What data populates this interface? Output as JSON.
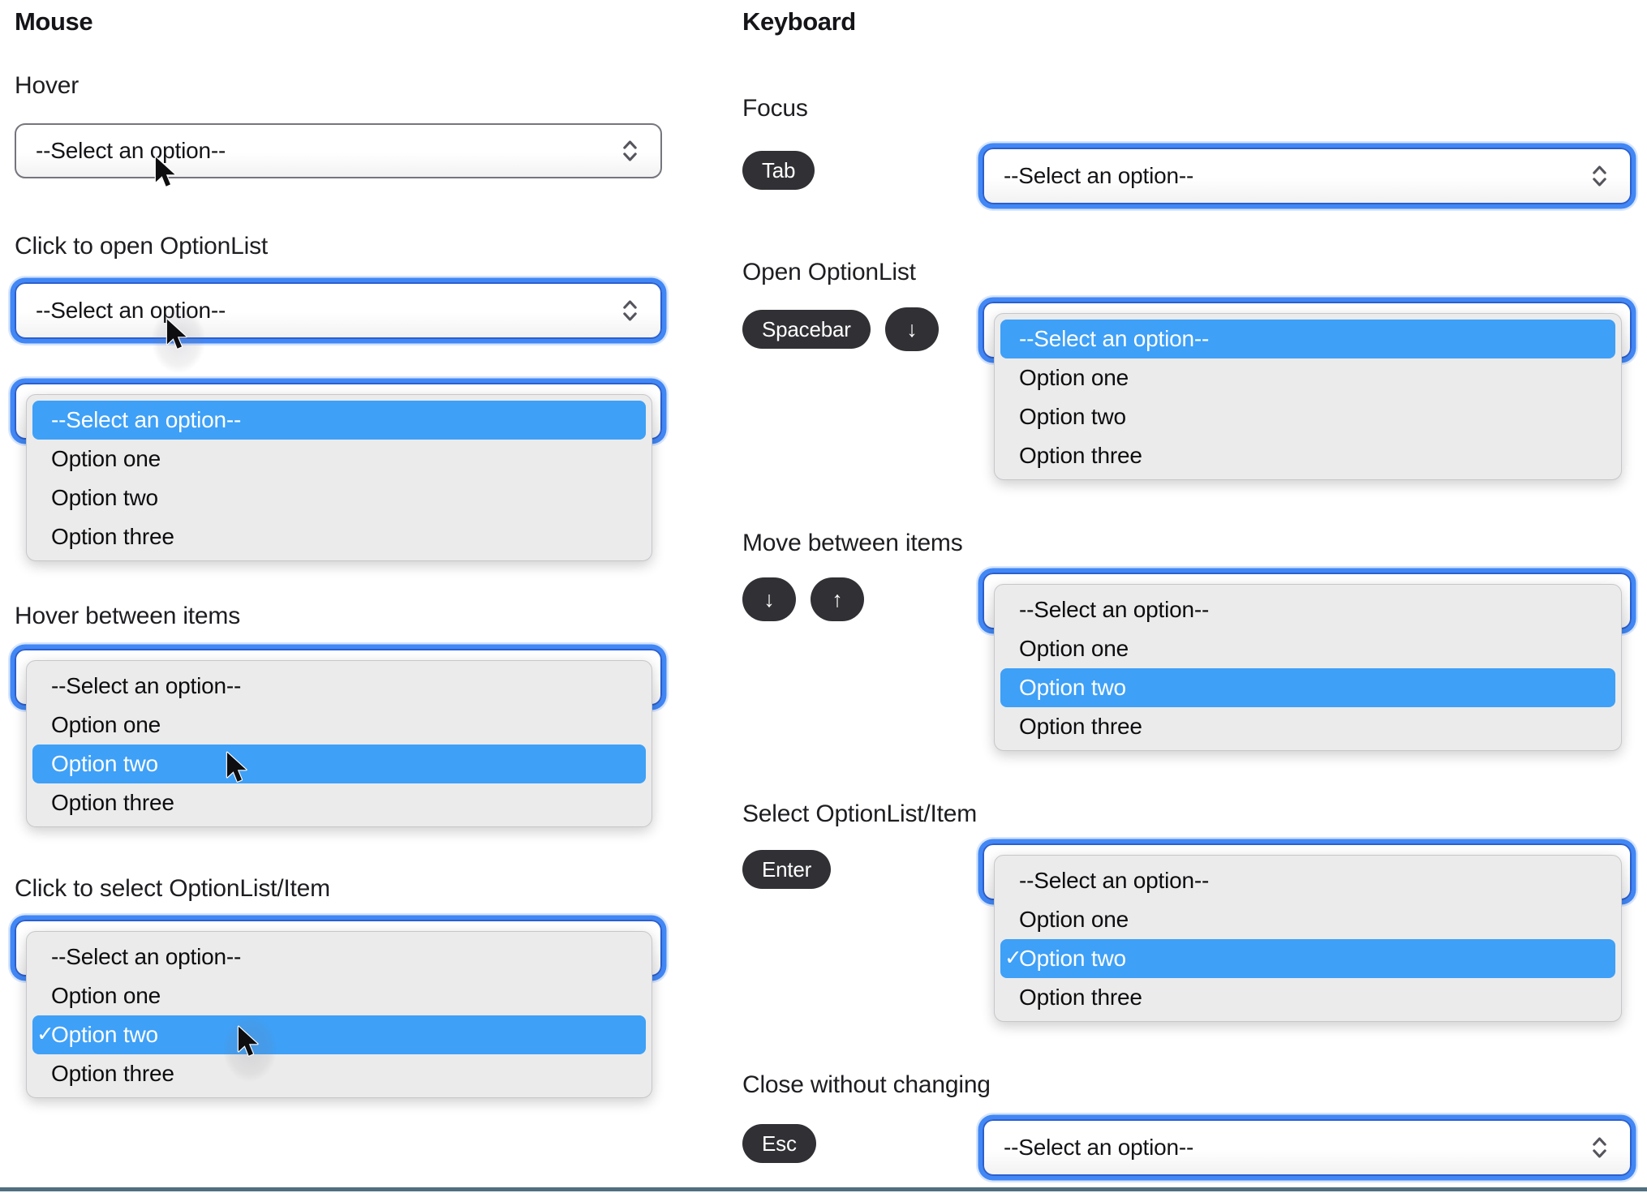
{
  "shared_select": {
    "placeholder": "--Select an option--",
    "options": [
      "--Select an option--",
      "Option one",
      "Option two",
      "Option three"
    ],
    "selected_checkmark": "✓"
  },
  "mouse_column": {
    "title": "Mouse",
    "sections": {
      "hover": "Hover",
      "click_open": "Click to open OptionList",
      "hover_between": "Hover between items",
      "click_select": "Click to select OptionList/Item"
    }
  },
  "keyboard_column": {
    "title": "Keyboard",
    "sections": {
      "focus": "Focus",
      "open": "Open OptionList",
      "move": "Move between items",
      "select": "Select OptionList/Item",
      "close": "Close without changing"
    },
    "keys": {
      "tab": "Tab",
      "spacebar": "Spacebar",
      "down": "↓",
      "up": "↑",
      "enter": "Enter",
      "esc": "Esc"
    }
  },
  "colors": {
    "highlight_blue": "#3EA0F7",
    "focus_ring_outer": "#4187F5",
    "focus_ring_inner": "#2B5FCE",
    "panel_bg": "#EBEBEB",
    "pill_bg": "#303035",
    "select_border": "#75757D",
    "bottom_divider": "#506F80"
  }
}
